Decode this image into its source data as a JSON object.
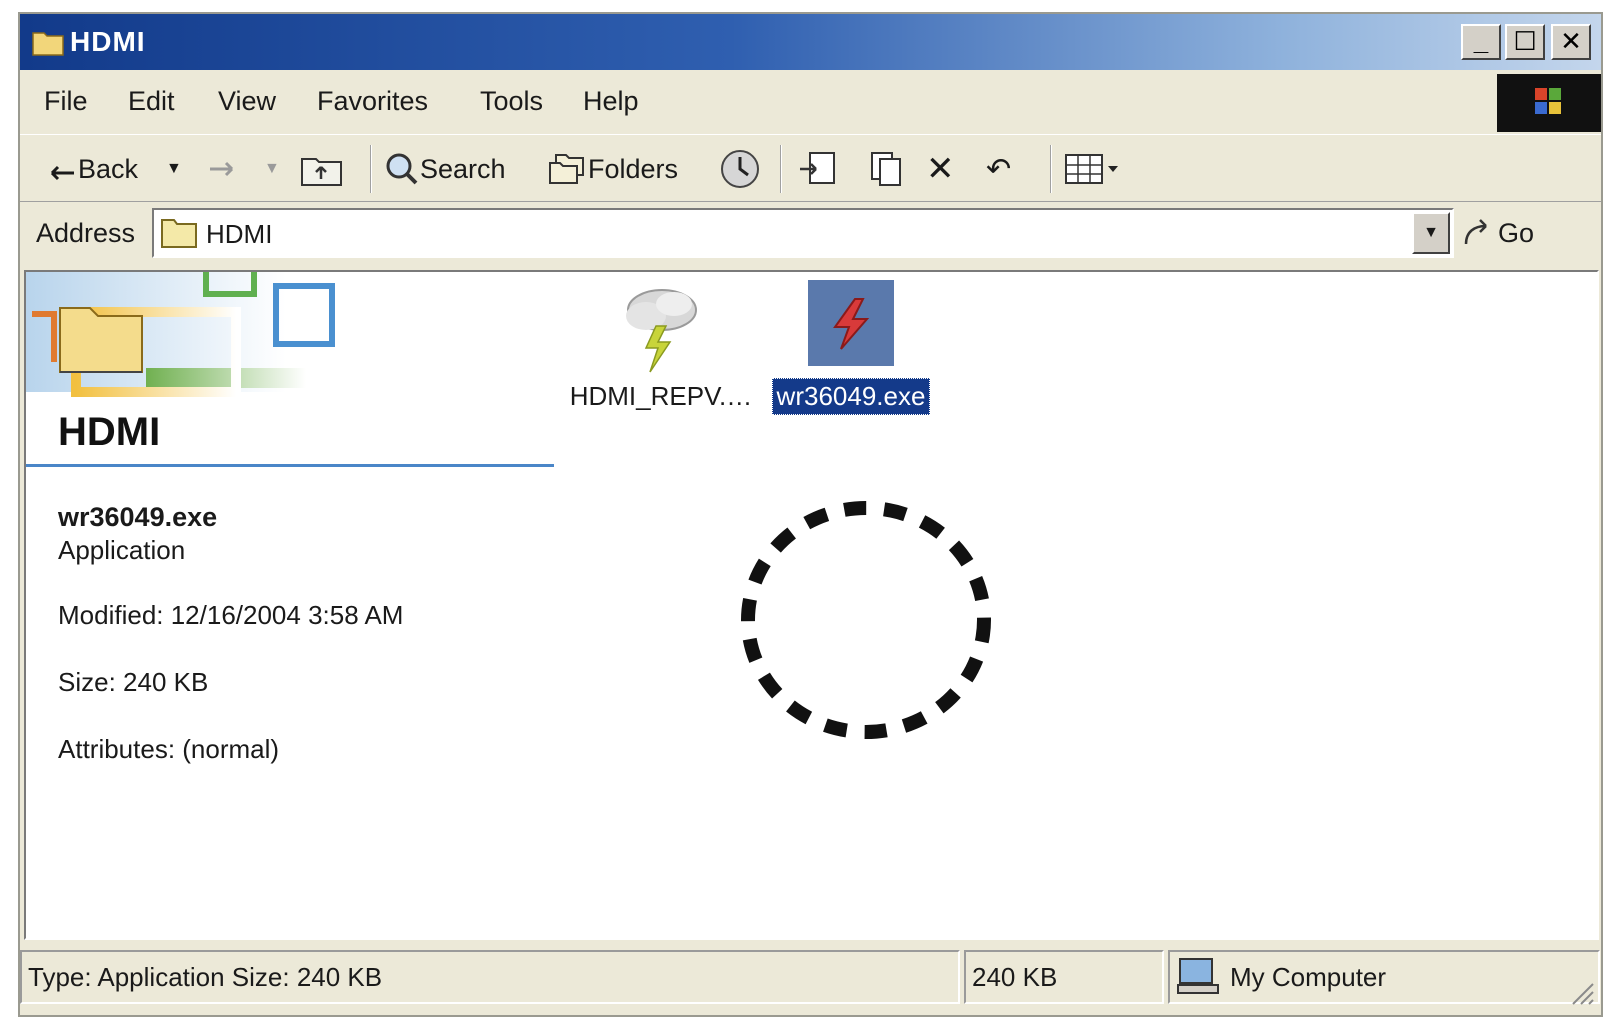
{
  "window": {
    "title": "HDMI"
  },
  "titlebar_buttons": {
    "minimize": "_",
    "maximize": "☐",
    "close": "✕"
  },
  "menu": [
    "File",
    "Edit",
    "View",
    "Favorites",
    "Tools",
    "Help"
  ],
  "toolbar": {
    "back_label": "Back",
    "search_label": "Search",
    "folders_label": "Folders"
  },
  "address": {
    "label": "Address",
    "value": "HDMI",
    "go_label": "Go"
  },
  "folder_panel": {
    "heading": "HDMI",
    "selected_name": "wr36049.exe",
    "selected_type": "Application",
    "modified": "Modified: 12/16/2004 3:58 AM",
    "size": "Size: 240 KB",
    "attributes": "Attributes: (normal)"
  },
  "files": [
    {
      "name": "HDMI_REPV.…",
      "icon": "weather-storm-icon",
      "selected": false
    },
    {
      "name": "wr36049.exe",
      "icon": "application-exe-icon",
      "selected": true
    }
  ],
  "status": {
    "main": "Type: Application Size: 240 KB",
    "size": "240 KB",
    "zone": "My Computer"
  },
  "colors": {
    "title_gradient_start": "#123a8a",
    "title_gradient_end": "#c4d6ec",
    "selection": "#143a8a",
    "heading_rule": "#4a86c8"
  }
}
